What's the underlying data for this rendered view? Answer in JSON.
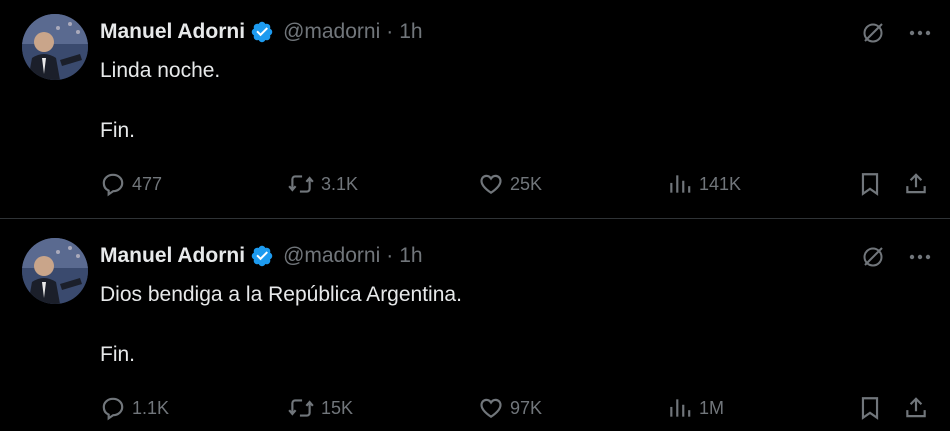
{
  "tweets": [
    {
      "author_name": "Manuel Adorni",
      "handle": "@madorni",
      "separator": "·",
      "time": "1h",
      "lines": [
        "Linda noche.",
        "Fin."
      ],
      "replies": "477",
      "retweets": "3.1K",
      "likes": "25K",
      "views": "141K"
    },
    {
      "author_name": "Manuel Adorni",
      "handle": "@madorni",
      "separator": "·",
      "time": "1h",
      "lines": [
        "Dios bendiga a la República Argentina.",
        "Fin."
      ],
      "replies": "1.1K",
      "retweets": "15K",
      "likes": "97K",
      "views": "1M"
    }
  ],
  "icons": {
    "verified": "verified-badge-icon",
    "grok": "grok-icon",
    "more": "more-icon",
    "reply": "reply-icon",
    "retweet": "retweet-icon",
    "like": "heart-icon",
    "views": "views-chart-icon",
    "bookmark": "bookmark-icon",
    "share": "share-icon"
  },
  "colors": {
    "background": "#000000",
    "text": "#e7e9ea",
    "muted": "#71767b",
    "verified": "#1d9bf0",
    "divider": "#2f3336"
  }
}
